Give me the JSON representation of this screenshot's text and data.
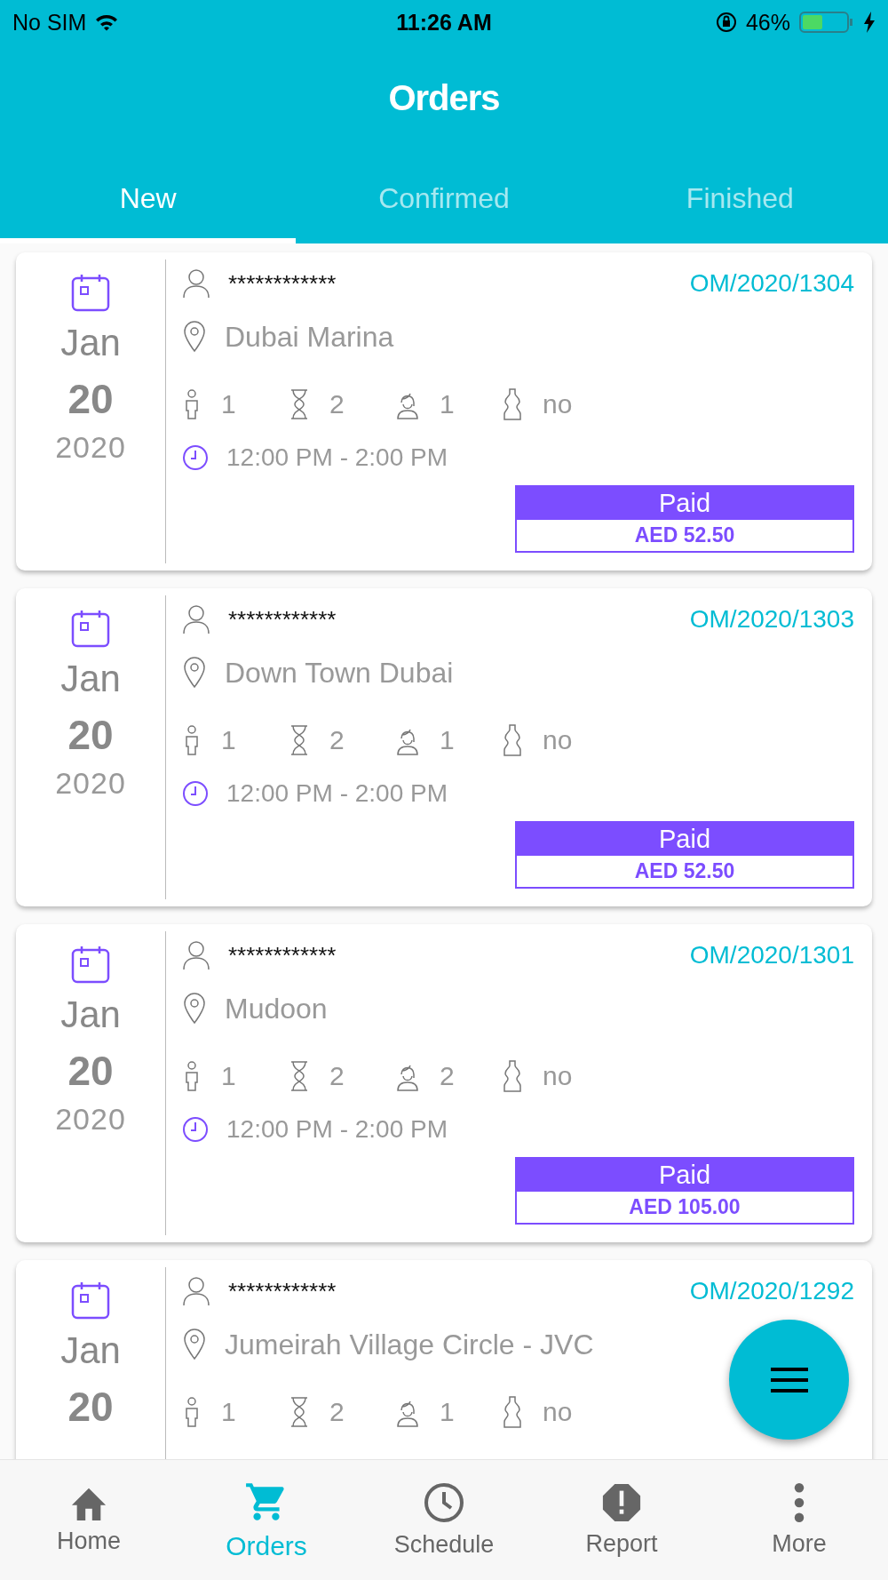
{
  "status_bar": {
    "carrier": "No SIM",
    "time": "11:26 AM",
    "battery": "46%"
  },
  "title": "Orders",
  "tabs": [
    {
      "label": "New",
      "selected": true
    },
    {
      "label": "Confirmed",
      "selected": false
    },
    {
      "label": "Finished",
      "selected": false
    }
  ],
  "orders": [
    {
      "month": "Jan",
      "day": "20",
      "year": "2020",
      "customer": "************",
      "number": "OM/2020/1304",
      "location": "Dubai Marina",
      "persons": "1",
      "hours": "2",
      "staff": "1",
      "materials": "no",
      "time": "12:00 PM - 2:00 PM",
      "payment": {
        "status": "Paid",
        "amount": "AED 52.50"
      }
    },
    {
      "month": "Jan",
      "day": "20",
      "year": "2020",
      "customer": "************",
      "number": "OM/2020/1303",
      "location": "Down Town Dubai",
      "persons": "1",
      "hours": "2",
      "staff": "1",
      "materials": "no",
      "time": "12:00 PM - 2:00 PM",
      "payment": {
        "status": "Paid",
        "amount": "AED 52.50"
      }
    },
    {
      "month": "Jan",
      "day": "20",
      "year": "2020",
      "customer": "************",
      "number": "OM/2020/1301",
      "location": "Mudoon",
      "persons": "1",
      "hours": "2",
      "staff": "2",
      "materials": "no",
      "time": "12:00 PM - 2:00 PM",
      "payment": {
        "status": "Paid",
        "amount": "AED 105.00"
      }
    },
    {
      "month": "Jan",
      "day": "20",
      "customer": "************",
      "number": "OM/2020/1292",
      "location": "Jumeirah Village Circle - JVC",
      "persons": "1",
      "hours": "2",
      "staff": "1",
      "materials": "no"
    }
  ],
  "nav": [
    {
      "kind": "home",
      "label": "Home",
      "selected": false
    },
    {
      "kind": "cart",
      "label": "Orders",
      "selected": true
    },
    {
      "kind": "clock",
      "label": "Schedule",
      "selected": false
    },
    {
      "kind": "alert",
      "label": "Report",
      "selected": false
    },
    {
      "kind": "more",
      "label": "More",
      "selected": false
    }
  ]
}
